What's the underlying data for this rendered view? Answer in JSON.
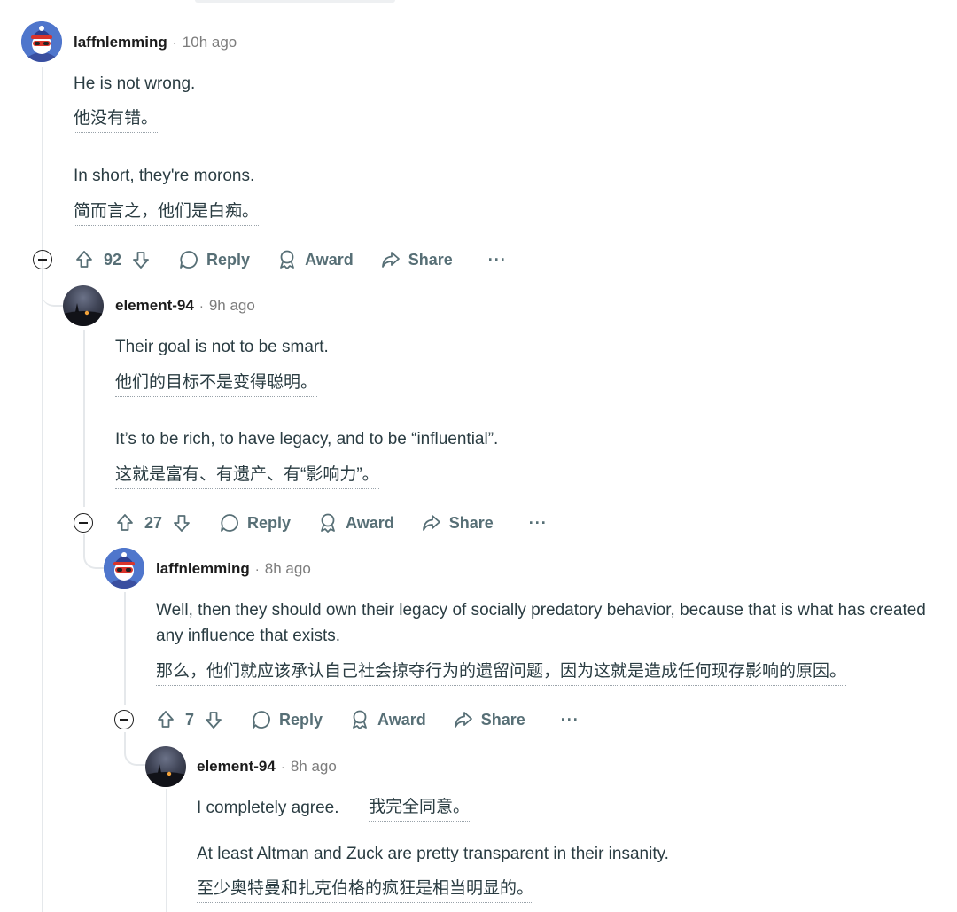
{
  "comments": [
    {
      "author": "laffnlemming",
      "time": "10h ago",
      "paragraphs": [
        {
          "en": "He is not wrong.",
          "zh": "他没有错。"
        },
        {
          "en": "In short, they're morons.",
          "zh": "简而言之，他们是白痴。"
        }
      ],
      "score": "92"
    },
    {
      "author": "element-94",
      "time": "9h ago",
      "paragraphs": [
        {
          "en": "Their goal is not to be smart.",
          "zh": "他们的目标不是变得聪明。"
        },
        {
          "en": "It’s to be rich, to have legacy, and to be “influential”.",
          "zh": "这就是富有、有遗产、有“影响力”。"
        }
      ],
      "score": "27"
    },
    {
      "author": "laffnlemming",
      "time": "8h ago",
      "paragraphs": [
        {
          "en": "Well, then they should own their legacy of socially predatory behavior, because that is what has created any influence that exists.",
          "zh": "那么，他们就应该承认自己社会掠夺行为的遗留问题，因为这就是造成任何现存影响的原因。"
        }
      ],
      "score": "7"
    },
    {
      "author": "element-94",
      "time": "8h ago",
      "paragraphs": [
        {
          "en": "I completely agree.",
          "zh": "我完全同意。"
        },
        {
          "en": "At least Altman and Zuck are pretty transparent in their insanity.",
          "zh": "至少奥特曼和扎克伯格的疯狂是相当明显的。"
        }
      ]
    }
  ],
  "labels": {
    "reply": "Reply",
    "award": "Award",
    "share": "Share",
    "more": "···",
    "separator": "·"
  },
  "icons": [
    "collapse-icon",
    "upvote-icon",
    "downvote-icon",
    "reply-icon",
    "award-icon",
    "share-icon",
    "more-icon"
  ],
  "colors": {
    "text": "#1c1c1c",
    "meta": "#7c7c7c",
    "action": "#576f76",
    "thread_line": "#e5e8eb"
  }
}
